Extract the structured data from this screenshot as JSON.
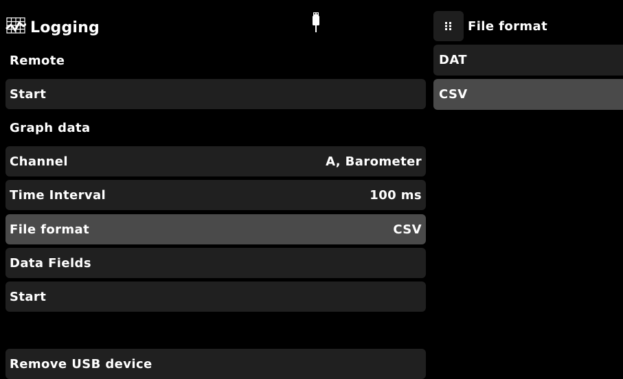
{
  "header": {
    "title": "Logging",
    "icon": "chart-grid-icon",
    "status_icon": "usb-icon"
  },
  "menu": [
    {
      "label": "Remote",
      "value": ""
    },
    {
      "label": "Start",
      "value": ""
    },
    {
      "label": "Graph data",
      "value": ""
    },
    {
      "label": "Channel",
      "value": "A, Barometer"
    },
    {
      "label": "Time Interval",
      "value": "100 ms"
    },
    {
      "label": "File format",
      "value": "CSV"
    },
    {
      "label": "Data Fields",
      "value": ""
    },
    {
      "label": "Start",
      "value": ""
    },
    {
      "label": "Remove USB device",
      "value": ""
    }
  ],
  "submenu": {
    "title": "File format",
    "icon": "grid-dots-icon",
    "options": [
      "DAT",
      "CSV"
    ],
    "selected": "CSV"
  },
  "colors": {
    "row_bg": "#202020",
    "selected_bg": "#4a4a4a",
    "background": "#000000",
    "text": "#ffffff"
  }
}
